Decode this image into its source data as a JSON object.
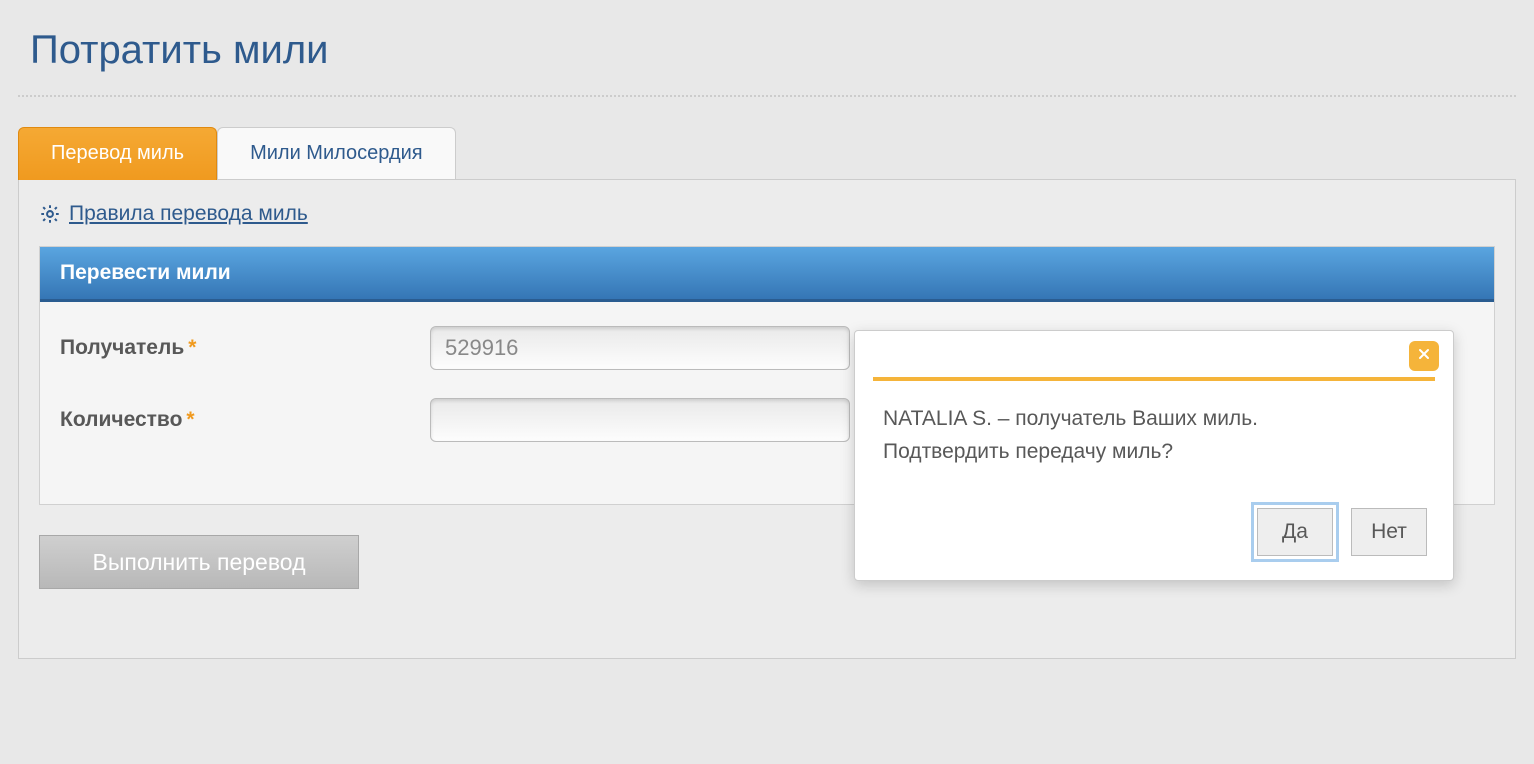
{
  "page": {
    "title": "Потратить мили"
  },
  "tabs": [
    {
      "label": "Перевод миль",
      "active": true
    },
    {
      "label": "Мили Милосердия",
      "active": false
    }
  ],
  "rules_link": "Правила перевода миль",
  "form": {
    "header": "Перевести мили",
    "recipient_label": "Получатель",
    "recipient_value": "529916",
    "amount_label": "Количество",
    "amount_value": "",
    "submit_label": "Выполнить перевод"
  },
  "dialog": {
    "line1": "NATALIA S. – получатель Ваших миль.",
    "line2": "Подтвердить передачу миль?",
    "yes": "Да",
    "no": "Нет"
  }
}
